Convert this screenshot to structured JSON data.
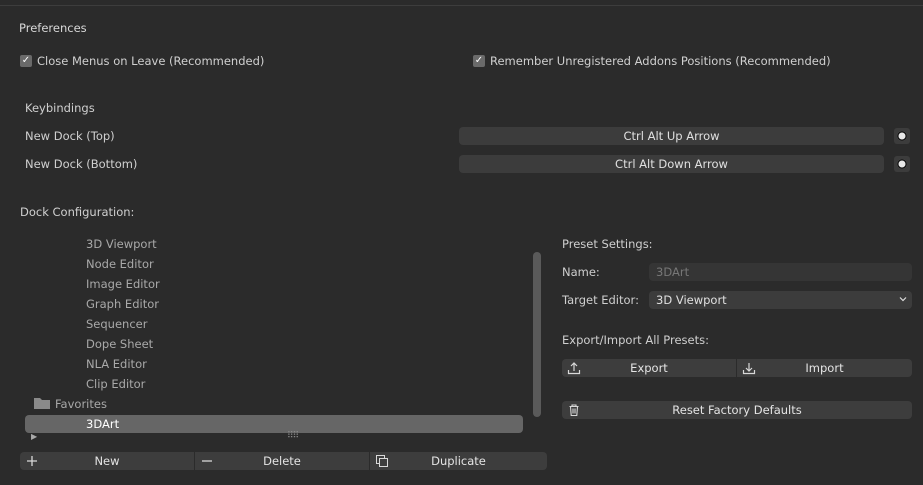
{
  "section": {
    "title": "Preferences"
  },
  "options": {
    "close_menus": {
      "label": "Close Menus on Leave (Recommended)",
      "checked": true
    },
    "remember_addons": {
      "label": "Remember Unregistered Addons Positions (Recommended)",
      "checked": true
    }
  },
  "keybindings": {
    "heading": "Keybindings",
    "items": [
      {
        "label": "New Dock (Top)",
        "shortcut": "Ctrl Alt Up Arrow"
      },
      {
        "label": "New Dock (Bottom)",
        "shortcut": "Ctrl Alt Down Arrow"
      }
    ]
  },
  "dock": {
    "heading": "Dock Configuration:",
    "tree": [
      "3D Viewport",
      "Node Editor",
      "Image Editor",
      "Graph Editor",
      "Sequencer",
      "Dope Sheet",
      "NLA Editor",
      "Clip Editor"
    ],
    "folder": "Favorites",
    "selected": "3DArt",
    "buttons": {
      "new": "New",
      "delete": "Delete",
      "duplicate": "Duplicate"
    }
  },
  "preset": {
    "heading": "Preset Settings:",
    "name_label": "Name:",
    "name_value": "3DArt",
    "target_label": "Target Editor:",
    "target_value": "3D Viewport",
    "export_import_heading": "Export/Import All Presets:",
    "export": "Export",
    "import": "Import",
    "reset": "Reset Factory Defaults"
  },
  "colors": {
    "background": "#2b2b2b",
    "button": "#3d3d3d",
    "selected": "#666666"
  }
}
